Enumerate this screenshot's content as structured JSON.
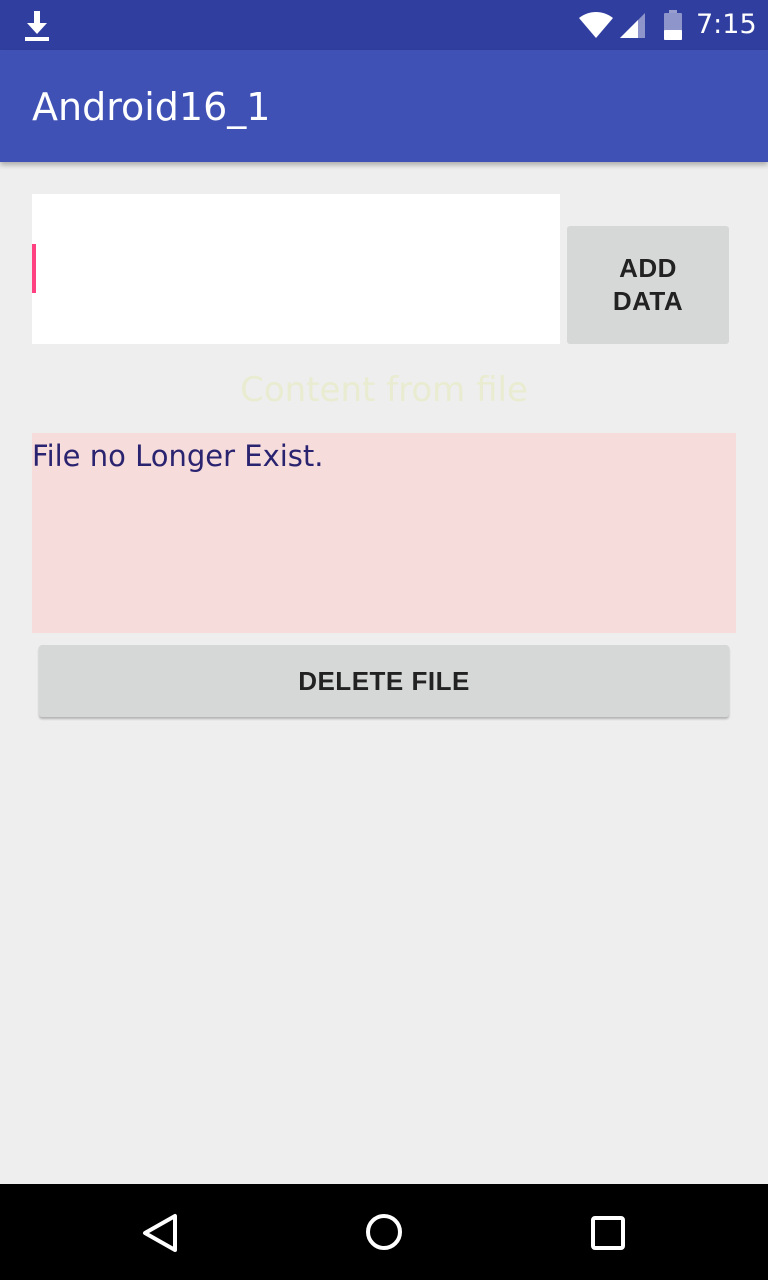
{
  "status_bar": {
    "time": "7:15",
    "icons": [
      "download-icon",
      "wifi-icon",
      "signal-icon",
      "battery-icon"
    ]
  },
  "app_bar": {
    "title": "Android16_1"
  },
  "form": {
    "input_value": "",
    "add_button_label": "ADD\nDATA"
  },
  "content": {
    "heading": "Content from file",
    "text": "File no Longer Exist."
  },
  "actions": {
    "delete_button_label": "DELETE FILE"
  },
  "nav_bar": {
    "icons": [
      "back-icon",
      "home-icon",
      "recents-icon"
    ]
  },
  "colors": {
    "status_bar": "#303f9f",
    "app_bar": "#3f51b5",
    "accent": "#ff4081",
    "content_background": "#f7dcdc",
    "content_text": "#2a236f",
    "heading_text": "#e9ecd0",
    "button_background": "#d6d7d7"
  }
}
